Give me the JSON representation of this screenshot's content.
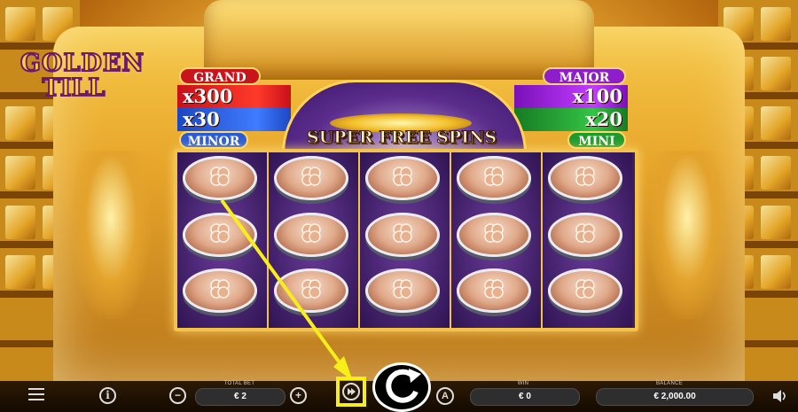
{
  "game": {
    "logo_line1": "GOLDEN",
    "logo_line2": "TILL"
  },
  "jackpots": {
    "grand": {
      "label": "GRAND",
      "value": "x300",
      "color": "#d9161e"
    },
    "minor": {
      "label": "MINOR",
      "value": "x30",
      "color": "#2a5bd6"
    },
    "major": {
      "label": "MAJOR",
      "value": "x100",
      "color": "#8e1ec9"
    },
    "mini": {
      "label": "MINI",
      "value": "x20",
      "color": "#1f9a2c"
    }
  },
  "feature_title": "SUPER FREE SPINS",
  "reels": {
    "columns": 5,
    "rows": 3,
    "symbol": "silver-clover-coin"
  },
  "annotation": {
    "color": "#f7ee1a",
    "target": "skip-button"
  },
  "bottom_bar": {
    "menu_icon": "hamburger-icon",
    "info_icon": "info-icon",
    "total_bet_caption": "TOTAL BET",
    "total_bet_value": "€ 2",
    "decrease_icon": "minus-icon",
    "increase_icon": "plus-icon",
    "skip_icon": "fast-forward-icon",
    "spin_icon": "refresh-icon",
    "autoplay_icon": "autoplay-icon",
    "win_caption": "WIN",
    "win_value": "€ 0",
    "balance_caption": "BALANCE",
    "balance_value": "€ 2,000.00",
    "sound_icon": "speaker-icon"
  }
}
